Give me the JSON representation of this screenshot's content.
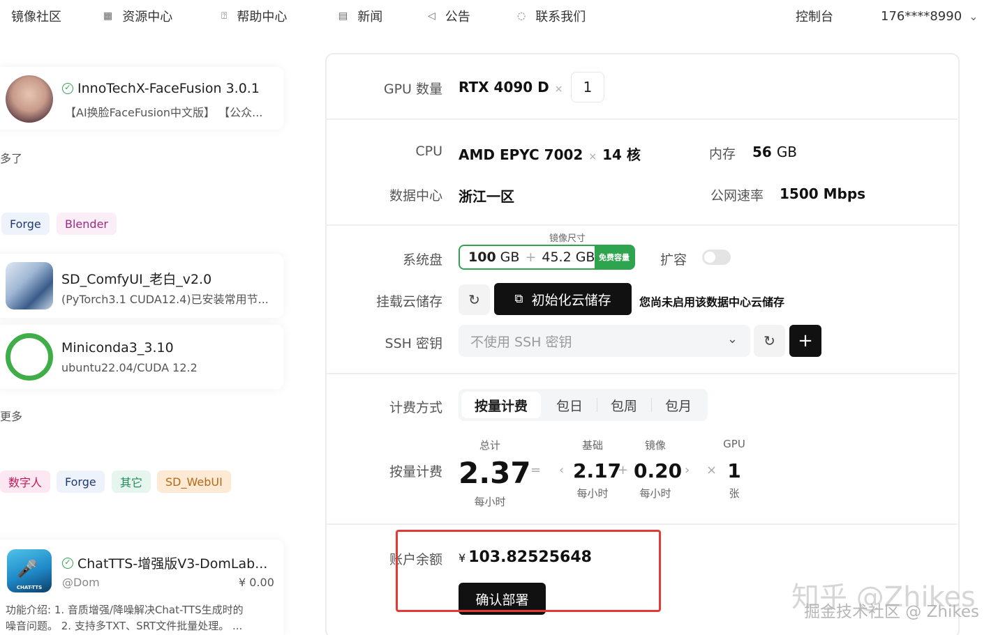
{
  "nav": {
    "brand": "镜像社区",
    "items": [
      {
        "label": "资源中心",
        "icon": "grid-icon"
      },
      {
        "label": "帮助中心",
        "icon": "help-icon"
      },
      {
        "label": "新闻",
        "icon": "news-icon"
      },
      {
        "label": "公告",
        "icon": "megaphone-icon"
      },
      {
        "label": "联系我们",
        "icon": "headset-icon"
      }
    ],
    "console": "控制台",
    "user": "176****8990"
  },
  "left": {
    "card1": {
      "title": "InnoTechX-FaceFusion 3.0.1",
      "sub": "【AI换脸FaceFusion中文版】 【公众..."
    },
    "more1": "多了",
    "tags1": [
      "Forge",
      "Blender"
    ],
    "card2": {
      "title": "SD_ComfyUI_老白_v2.0",
      "sub": "(PyTorch3.1 CUDA12.4)已安装常用节..."
    },
    "card3": {
      "title": "Miniconda3_3.10",
      "sub": "ubuntu22.04/CUDA 12.2"
    },
    "more2": "更多",
    "tags2": [
      "数字人",
      "Forge",
      "其它",
      "SD_WebUI"
    ],
    "card4": {
      "title": "ChatTTS-增强版V3-DomLab...",
      "author": "@Dom",
      "price": "¥ 0.00",
      "avatar_text": "CHAT-TTS",
      "desc1": "功能介绍: 1. 音质增强/降噪解决Chat-TTS生成时的",
      "desc2": "噪音问题。 2. 支持多TXT、SRT文件批量处理。 ..."
    }
  },
  "config": {
    "gpu_label": "GPU 数量",
    "gpu_model": "RTX 4090 D",
    "times": "×",
    "gpu_count": "1",
    "cpu_label": "CPU",
    "cpu_model": "AMD EPYC 7002",
    "cpu_cores": "14 核",
    "mem_label": "内存",
    "mem_value": "56",
    "mem_unit": "GB",
    "dc_label": "数据中心",
    "dc_value": "浙江一区",
    "net_label": "公网速率",
    "net_value": "1500 Mbps",
    "image_size_label": "镜像尺寸",
    "disk_label": "系统盘",
    "disk_value": "100",
    "disk_unit": "GB",
    "plus": "+",
    "image_size_value": "45.2 GB",
    "free_badge": "免费容量",
    "expand_label": "扩容",
    "expand_enabled": false,
    "cloud_label": "挂载云储存",
    "init_cloud_button": "初始化云储存",
    "cloud_note": "您尚未启用该数据中心云储存",
    "ssh_label": "SSH 密钥",
    "ssh_placeholder": "不使用 SSH 密钥",
    "billing_label": "计费方式",
    "billing_options": [
      "按量计费",
      "包日",
      "包周",
      "包月"
    ],
    "billing_selected": "按量计费",
    "price_label": "按量计费",
    "price": {
      "total_label": "总计",
      "total": "2.37",
      "total_unit": "每小时",
      "eq": "=",
      "base_label": "基础",
      "base": "2.17",
      "base_unit": "每小时",
      "image_label": "镜像",
      "image": "0.20",
      "image_unit": "每小时",
      "gpu_label": "GPU",
      "gpu": "1",
      "gpu_unit": "张",
      "lt": "‹",
      "gt": "›",
      "mul": "×"
    },
    "balance_label": "账户余额",
    "balance_currency": "¥",
    "balance_value": "103.82525648",
    "deploy_button": "确认部署"
  },
  "watermark": {
    "line1": "知乎 @Zhikes",
    "line2": "掘金技术社区 @ Zhikes"
  },
  "colors": {
    "highlight_red": "#e53935",
    "free_green": "#2ea44f",
    "dark": "#111111"
  }
}
